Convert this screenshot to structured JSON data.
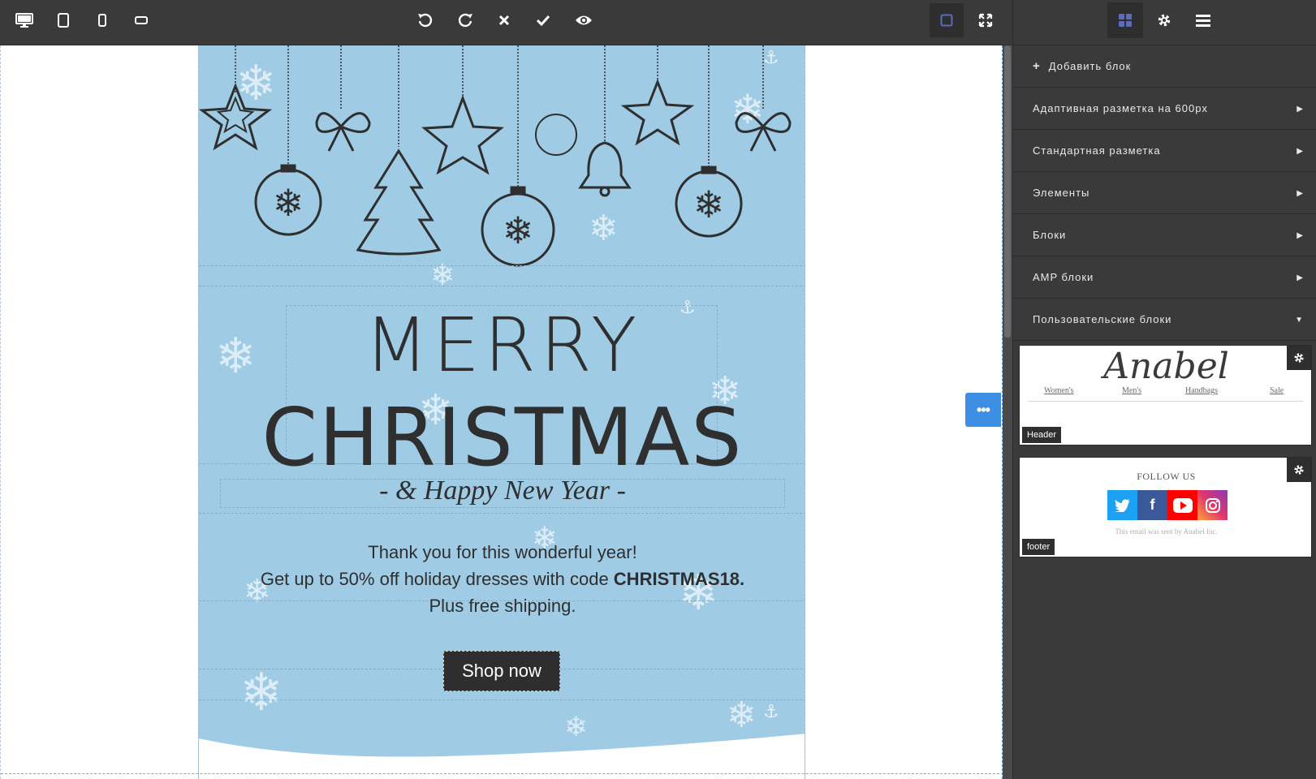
{
  "toolbar": {
    "left_icons": [
      "desktop-icon",
      "tablet-icon",
      "mobile-icon",
      "mobile-landscape-icon"
    ],
    "center_icons": [
      "undo-icon",
      "redo-icon",
      "close-icon",
      "check-icon",
      "eye-icon"
    ],
    "right_icons": [
      "outline-square-icon",
      "fullscreen-icon"
    ]
  },
  "email": {
    "heading_line1": "MERRY",
    "heading_line2": "CHRISTMAS",
    "subtitle": "- & Happy New Year -",
    "body_line1": "Thank you for this wonderful year!",
    "body_line2_prefix": "Get up to 50% off holiday dresses with code ",
    "body_line2_code": "CHRISTMAS18.",
    "body_line3": "Plus free shipping.",
    "cta_label": "Shop now",
    "colors": {
      "background": "#9fcbe4",
      "text": "#2f2f2f",
      "cta": "#2e2e2e"
    }
  },
  "canvas": {
    "more_button": "•••"
  },
  "panel": {
    "tabs": [
      "blocks-icon",
      "gear-icon",
      "menu-icon"
    ],
    "menu": [
      {
        "label": "Добавить блок",
        "has_plus": true
      },
      {
        "label": "Адаптивная разметка на 600px",
        "caret": "▶"
      },
      {
        "label": "Стандартная разметка",
        "caret": "▶"
      },
      {
        "label": "Элементы",
        "caret": "▶"
      },
      {
        "label": "Блоки",
        "caret": "▶"
      },
      {
        "label": "AMP блоки",
        "caret": "▶"
      },
      {
        "label": "Пользовательские блоки",
        "caret": "▼"
      }
    ],
    "saved_blocks": [
      {
        "tag": "Header",
        "logo": "Anabel",
        "nav": [
          "Women's",
          "Men's",
          "Handbags",
          "Sale"
        ]
      },
      {
        "tag": "footer",
        "follow": "FOLLOW US",
        "social": [
          "twitter-icon",
          "facebook-icon",
          "youtube-icon",
          "instagram-icon"
        ],
        "sent_by": "This email was sent by Anabel Inc."
      }
    ],
    "accent": "#5c6bc0"
  }
}
